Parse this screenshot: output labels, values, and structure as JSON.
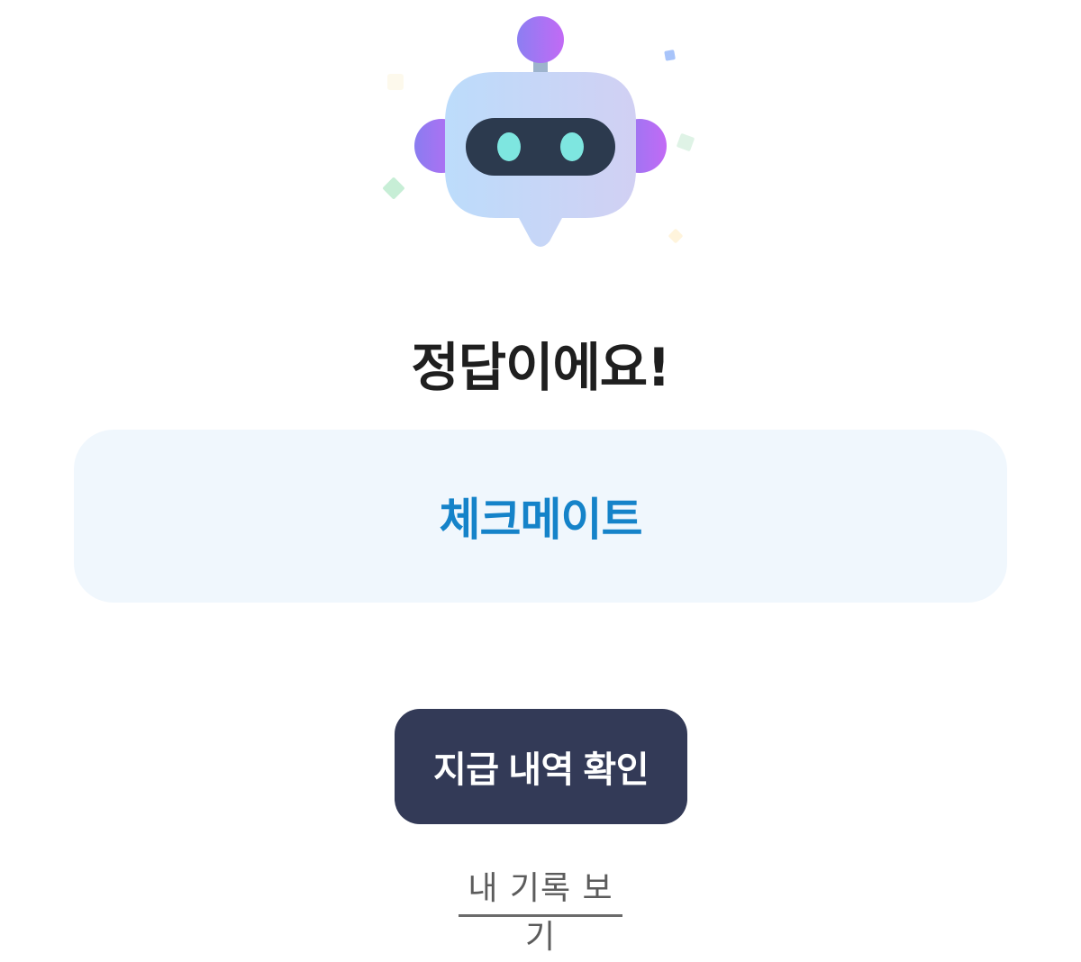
{
  "mascot": {
    "icon": "chatbot-robot-icon",
    "colors": {
      "head": "#bcdcfb",
      "head_right": "#d1d0f3",
      "visor": "#2c3a4e",
      "eyes": "#7ee6e0",
      "ears_from": "#8a7cf0",
      "ears_to": "#c26af5",
      "antenna": "#a66ef5"
    }
  },
  "result": {
    "title": "정답이에요!"
  },
  "answer": {
    "text": "체크메이트"
  },
  "actions": {
    "primary_label": "지급 내역 확인",
    "secondary_label": "내 기록 보기"
  },
  "colors": {
    "title": "#1f1f1f",
    "answer_text": "#1583c9",
    "answer_bg": "#f0f7fd",
    "button_bg": "#333a57",
    "button_text": "#ffffff",
    "link_text": "#5c5c5c"
  }
}
